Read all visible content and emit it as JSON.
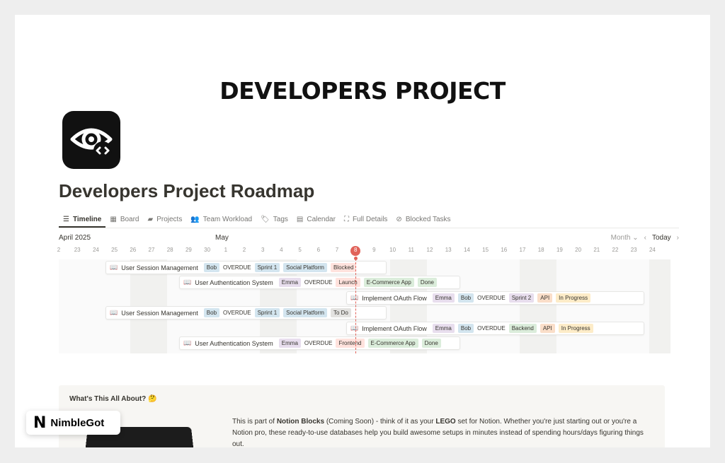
{
  "banner": {
    "title": "DEVELOPERS PROJECT"
  },
  "page": {
    "title": "Developers Project Roadmap",
    "icon": "eye-code-icon"
  },
  "tabs": [
    {
      "label": "Timeline",
      "icon": "timeline-icon",
      "active": true
    },
    {
      "label": "Board",
      "icon": "board-icon"
    },
    {
      "label": "Projects",
      "icon": "folder-icon"
    },
    {
      "label": "Team Workload",
      "icon": "people-icon"
    },
    {
      "label": "Tags",
      "icon": "tag-icon"
    },
    {
      "label": "Calendar",
      "icon": "calendar-icon"
    },
    {
      "label": "Full Details",
      "icon": "expand-icon"
    },
    {
      "label": "Blocked Tasks",
      "icon": "blocked-icon"
    }
  ],
  "timeline": {
    "month_a": "April 2025",
    "month_b": "May",
    "view_label": "Month",
    "today_label": "Today",
    "days": [
      "2",
      "23",
      "24",
      "25",
      "26",
      "27",
      "28",
      "29",
      "30",
      "1",
      "2",
      "3",
      "4",
      "5",
      "6",
      "7",
      "8",
      "9",
      "10",
      "11",
      "12",
      "13",
      "14",
      "15",
      "16",
      "17",
      "18",
      "19",
      "20",
      "21",
      "22",
      "23",
      "24"
    ],
    "today_index": 16,
    "rows": [
      {
        "name": "User Session Management",
        "fields": [
          "Bob",
          "OVERDUE",
          "Sprint 1",
          "Social Platform",
          "Blocked"
        ]
      },
      {
        "name": "User Authentication System",
        "fields": [
          "Emma",
          "OVERDUE",
          "Launch",
          "E-Commerce App",
          "Done"
        ]
      },
      {
        "name": "Implement OAuth Flow",
        "fields": [
          "Emma",
          "Bob",
          "OVERDUE",
          "Sprint 2",
          "API",
          "In Progress"
        ]
      },
      {
        "name": "User Session Management",
        "fields": [
          "Bob",
          "OVERDUE",
          "Sprint 1",
          "Social Platform",
          "To Do"
        ]
      },
      {
        "name": "Implement OAuth Flow",
        "fields": [
          "Emma",
          "Bob",
          "OVERDUE",
          "Backend",
          "API",
          "In Progress"
        ]
      },
      {
        "name": "User Authentication System",
        "fields": [
          "Emma",
          "OVERDUE",
          "Frontend",
          "E-Commerce App",
          "Done"
        ]
      }
    ]
  },
  "callout": {
    "title": "What's This All About? 🤔",
    "text_1": "This is part of ",
    "text_bold_1": "Notion Blocks",
    "text_2": " (Coming Soon) - think of it as your ",
    "text_bold_2": "LEGO",
    "text_3": " set for Notion. Whether you're just starting out or you're a Notion pro, these ready-to-use databases help you build awesome setups in minutes instead of spending hours/days figuring things out."
  },
  "watermark": {
    "logo": "N",
    "name": "NimbleGot"
  },
  "colors": {
    "blue_tag": "#d3e5ef",
    "green_tag": "#dbeddb",
    "red_tag": "#ffe2dd",
    "purple_tag": "#e8deee",
    "orange_tag": "#fadec9",
    "yellow_tag": "#fdecc8",
    "gray_tag": "#e3e2e0",
    "today": "#e16259"
  }
}
